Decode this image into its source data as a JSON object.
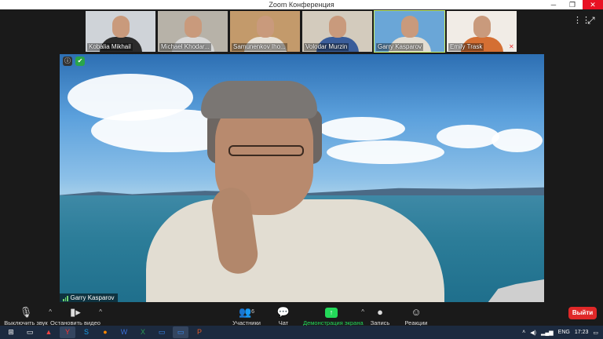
{
  "window": {
    "title": "Zoom Конференция",
    "minimize_glyph": "─",
    "restore_glyph": "❐",
    "close_glyph": "✕"
  },
  "thumbnails": [
    {
      "name": "Kobalia Mikhail",
      "bg": "#cfd3d8",
      "shirt": "#2b2b2b",
      "muted": false
    },
    {
      "name": "Michael Khodar...",
      "bg": "#b7b2a8",
      "shirt": "#d8d8d8",
      "muted": false
    },
    {
      "name": "Samunenkov Iho...",
      "bg": "#c39a6b",
      "shirt": "#e7e1d7",
      "muted": false
    },
    {
      "name": "Volodar Murzin",
      "bg": "#d3cbbd",
      "shirt": "#3a5d9a",
      "muted": false
    },
    {
      "name": "Garry Kasparov",
      "bg": "#6aa6d7",
      "shirt": "#e2ddd2",
      "muted": false,
      "active": true
    },
    {
      "name": "Emily Trask",
      "bg": "#f1ece6",
      "shirt": "#d46f33",
      "muted": true
    }
  ],
  "main_video": {
    "speaker_name": "Garry  Kasparov"
  },
  "toolbar": {
    "mute_label": "Выключить звук",
    "video_label": "Остановить видео",
    "participants_label": "Участники",
    "participants_count": "6",
    "chat_label": "Чат",
    "share_label": "Демонстрация экрана",
    "record_label": "Запись",
    "reactions_label": "Реакции",
    "leave_label": "Выйти"
  },
  "icons": {
    "mic": "🎙",
    "camera": "▮▸",
    "participants": "👥",
    "chat": "💬",
    "share": "↑",
    "record": "●",
    "reactions": "☺",
    "caret": "^",
    "grid": "⋮⋮",
    "fullscreen": "⤢"
  },
  "colors": {
    "share_green": "#23d959",
    "leave_red": "#e02828",
    "active_border": "#c6f06a"
  },
  "taskbar": {
    "language": "ENG",
    "time": "17:23"
  }
}
